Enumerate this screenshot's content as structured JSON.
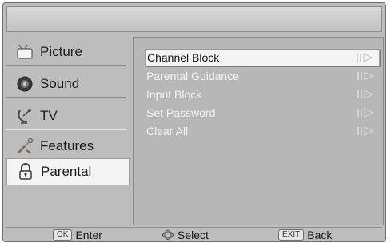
{
  "sidebar": {
    "items": [
      {
        "label": "Picture",
        "icon": "picture-icon"
      },
      {
        "label": "Sound",
        "icon": "sound-icon"
      },
      {
        "label": "TV",
        "icon": "tv-icon"
      },
      {
        "label": "Features",
        "icon": "features-icon"
      },
      {
        "label": "Parental",
        "icon": "lock-icon",
        "active": true
      }
    ]
  },
  "content": {
    "items": [
      {
        "label": "Channel Block",
        "selected": true
      },
      {
        "label": "Parental Guidance"
      },
      {
        "label": "Input Block"
      },
      {
        "label": "Set Password"
      },
      {
        "label": "Clear All"
      }
    ]
  },
  "footer": {
    "enter": {
      "key": "OK",
      "label": "Enter"
    },
    "select": {
      "label": "Select"
    },
    "back": {
      "key": "EXIT",
      "label": "Back"
    }
  },
  "colors": {
    "frame_bg": "#bdbdbd",
    "panel_bg": "#b7b7b7",
    "selected_bg": "#f5f5f5"
  }
}
